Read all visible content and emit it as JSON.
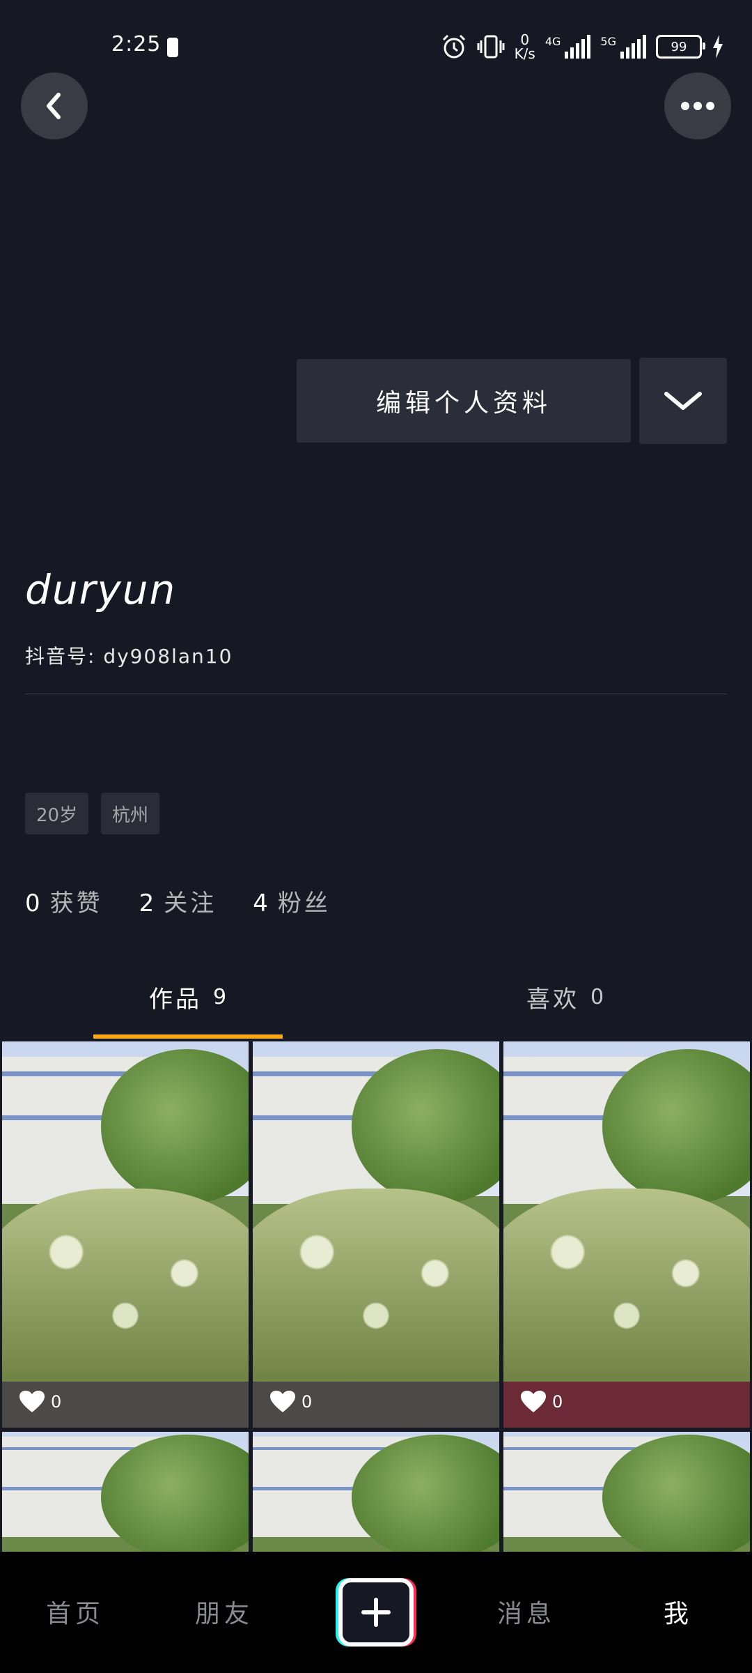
{
  "status_bar": {
    "time": "2:25",
    "net_speed_value": "0",
    "net_speed_unit": "K/s",
    "sim1_label": "4G",
    "sim2_label": "5G",
    "battery_level": "99"
  },
  "profile": {
    "edit_button_label": "编辑个人资料",
    "username": "duryun",
    "douyin_id": "抖音号: dy908lan10",
    "tags": [
      "20岁",
      "杭州"
    ],
    "stats": {
      "likes_count": "0",
      "likes_label": "获赞",
      "following_count": "2",
      "following_label": "关注",
      "followers_count": "4",
      "followers_label": "粉丝"
    }
  },
  "tabs": {
    "works_label": "作品",
    "works_count": "9",
    "likes_label": "喜欢",
    "likes_count": "0"
  },
  "grid": {
    "items": [
      {
        "likes": "0"
      },
      {
        "likes": "0"
      },
      {
        "likes": "0"
      },
      {
        "likes": ""
      },
      {
        "likes": ""
      },
      {
        "likes": ""
      }
    ]
  },
  "bottom_nav": {
    "home": "首页",
    "friends": "朋友",
    "messages": "消息",
    "me": "我"
  },
  "colors": {
    "background": "#161823",
    "tab_indicator": "#f7a81b",
    "plus_red": "#fe2c55",
    "plus_cyan": "#25f4ee"
  }
}
